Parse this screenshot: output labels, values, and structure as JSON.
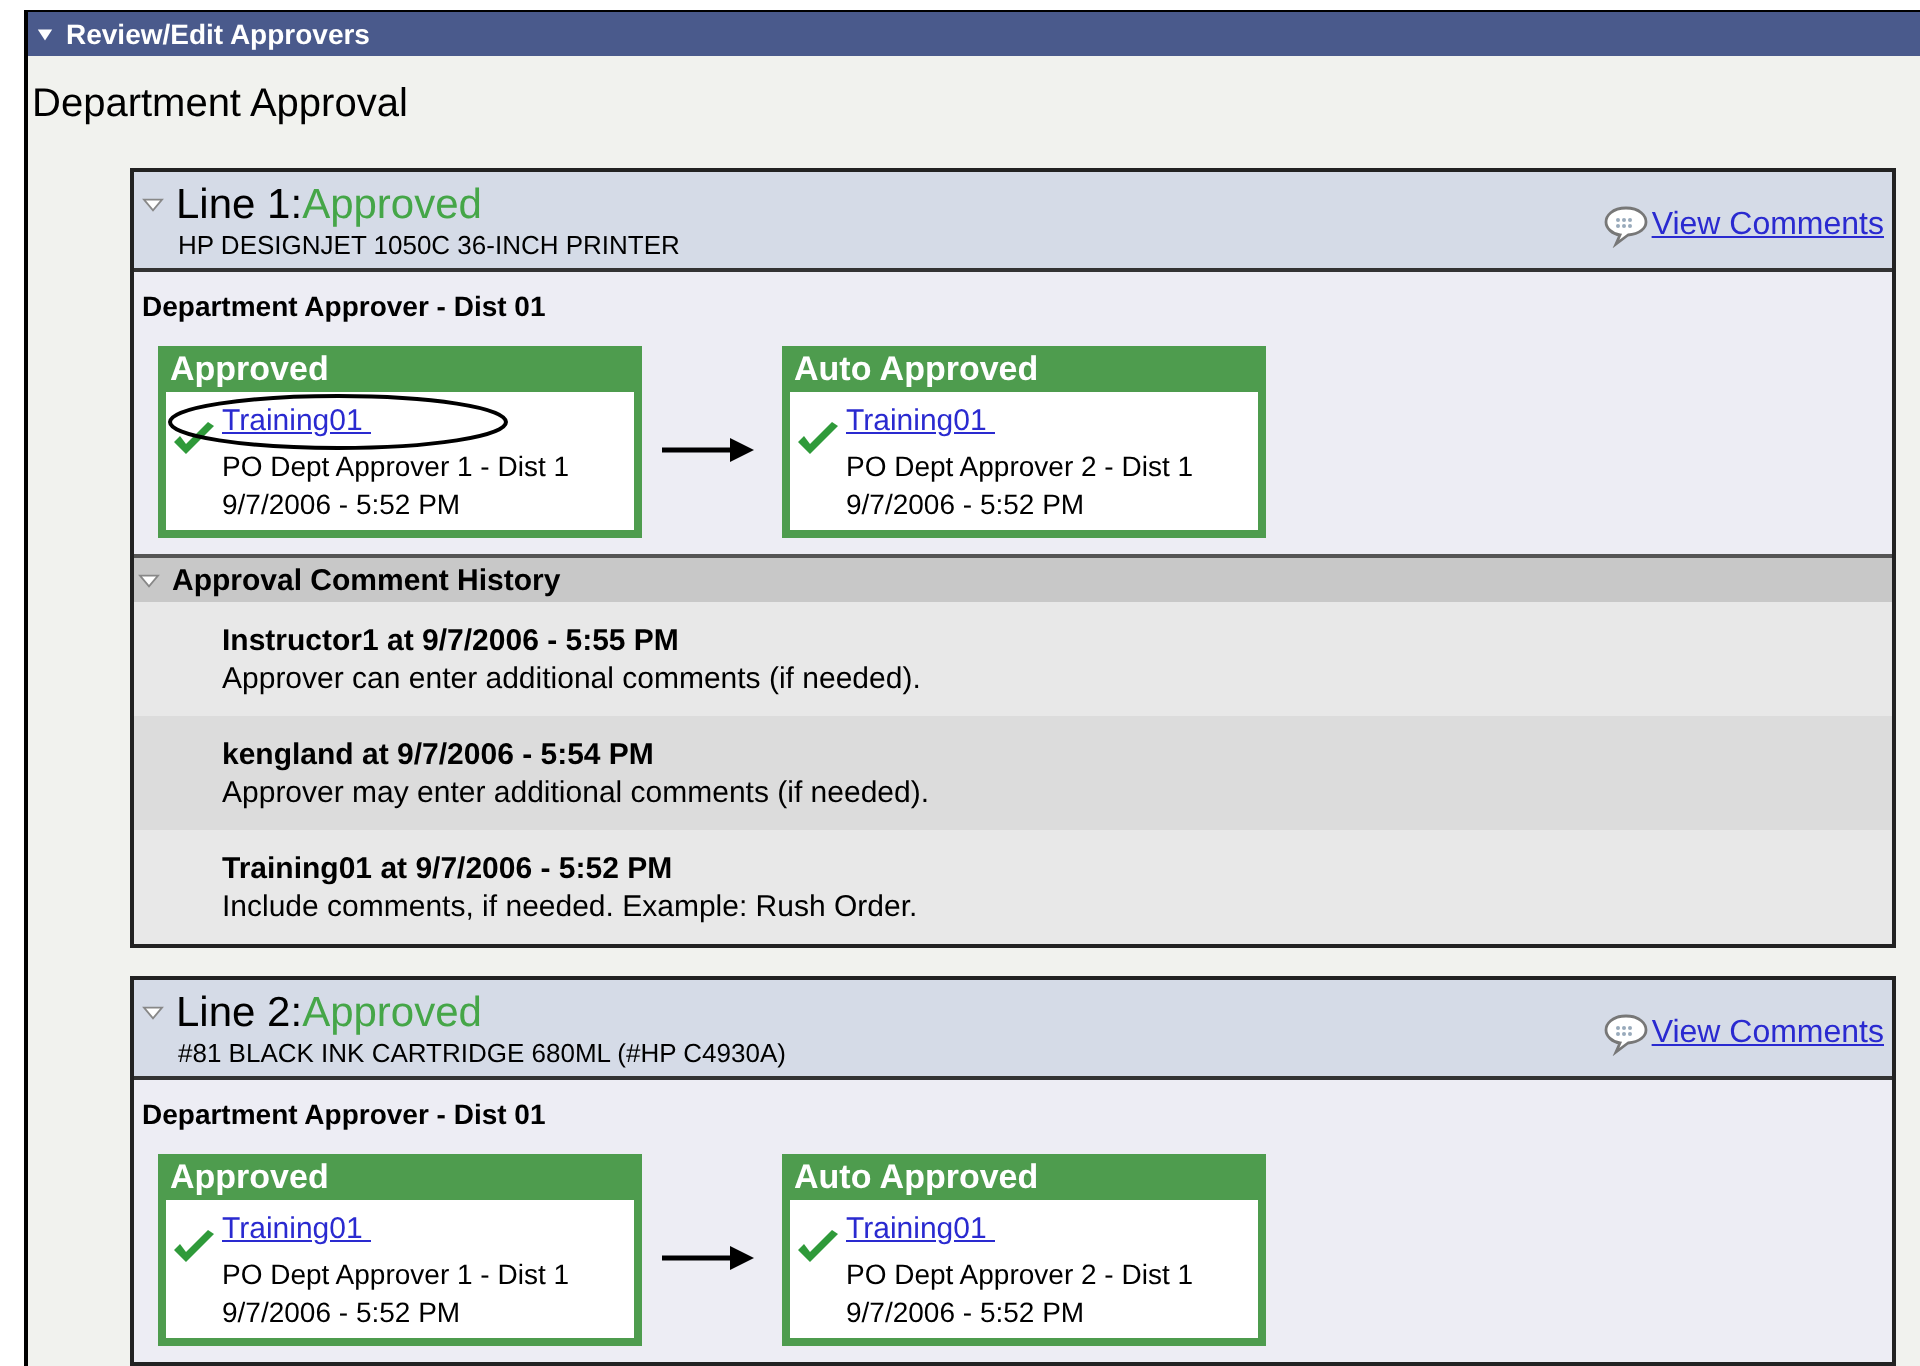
{
  "section_header": {
    "title": "Review/Edit Approvers",
    "expanded": true
  },
  "page_title": "Department Approval",
  "lines": [
    {
      "label": "Line 1:",
      "status": "Approved",
      "description": "HP DESIGNJET 1050C 36-INCH PRINTER",
      "expanded": true,
      "view_comments": "View Comments",
      "approver_group": "Department Approver - Dist 01",
      "steps": [
        {
          "status": "Approved",
          "approver": "Training01",
          "role": "PO Dept Approver 1 - Dist 1",
          "datetime": "9/7/2006 - 5:52 PM",
          "approved": true,
          "circled": true
        },
        {
          "status": "Auto Approved",
          "approver": "Training01",
          "role": "PO Dept Approver 2 - Dist 1",
          "datetime": "9/7/2006 - 5:52 PM",
          "approved": true,
          "circled": false
        }
      ],
      "comment_history": {
        "title": "Approval Comment History",
        "expanded": true,
        "comments": [
          {
            "author": "Instructor1 at 9/7/2006 - 5:55 PM",
            "text": "Approver can enter additional comments (if needed)."
          },
          {
            "author": "kengland at 9/7/2006 - 5:54 PM",
            "text": "Approver may enter additional comments (if needed)."
          },
          {
            "author": "Training01 at 9/7/2006 - 5:52 PM",
            "text": "Include comments, if needed. Example: Rush Order."
          }
        ]
      }
    },
    {
      "label": "Line 2:",
      "status": "Approved",
      "description": "#81 BLACK INK CARTRIDGE 680ML (#HP C4930A)",
      "expanded": true,
      "view_comments": "View Comments",
      "approver_group": "Department Approver - Dist 01",
      "steps": [
        {
          "status": "Approved",
          "approver": "Training01",
          "role": "PO Dept Approver 1 - Dist 1",
          "datetime": "9/7/2006 - 5:52 PM",
          "approved": true,
          "circled": false
        },
        {
          "status": "Auto Approved",
          "approver": "Training01",
          "role": "PO Dept Approver 2 - Dist 1",
          "datetime": "9/7/2006 - 5:52 PM",
          "approved": true,
          "circled": false
        }
      ]
    }
  ]
}
